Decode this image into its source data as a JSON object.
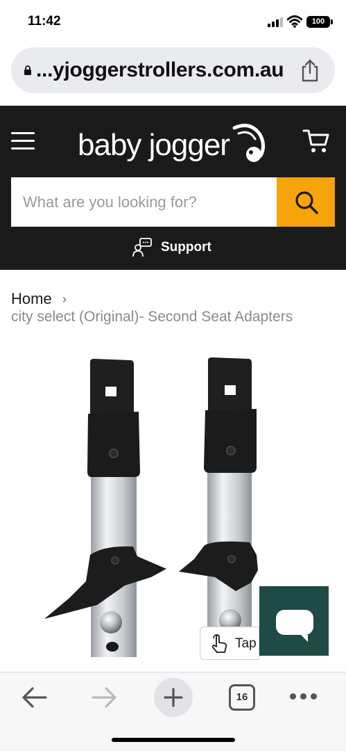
{
  "status_bar": {
    "time": "11:42",
    "battery": "100"
  },
  "browser": {
    "url": "...yjoggerstrollers.com.au",
    "open_tabs_count": "16"
  },
  "header": {
    "logo_text": "baby jogger",
    "search": {
      "placeholder": "What are you looking for?",
      "button_color": "#f7a30a"
    },
    "support_label": "Support",
    "background_color": "#1a1a1a"
  },
  "breadcrumb": {
    "home_label": "Home",
    "separator": "›",
    "current_page": "city select (Original)- Second Seat Adapters"
  },
  "chat_widget": {
    "background_color": "#1f4a46",
    "tooltip_label": "Tap"
  },
  "icons": [
    "lock-icon",
    "share-icon",
    "menu-icon",
    "cart-icon",
    "search-icon",
    "support-icon",
    "chat-icon",
    "tap-hand-icon",
    "back-icon",
    "forward-icon",
    "plus-icon",
    "more-icon"
  ]
}
